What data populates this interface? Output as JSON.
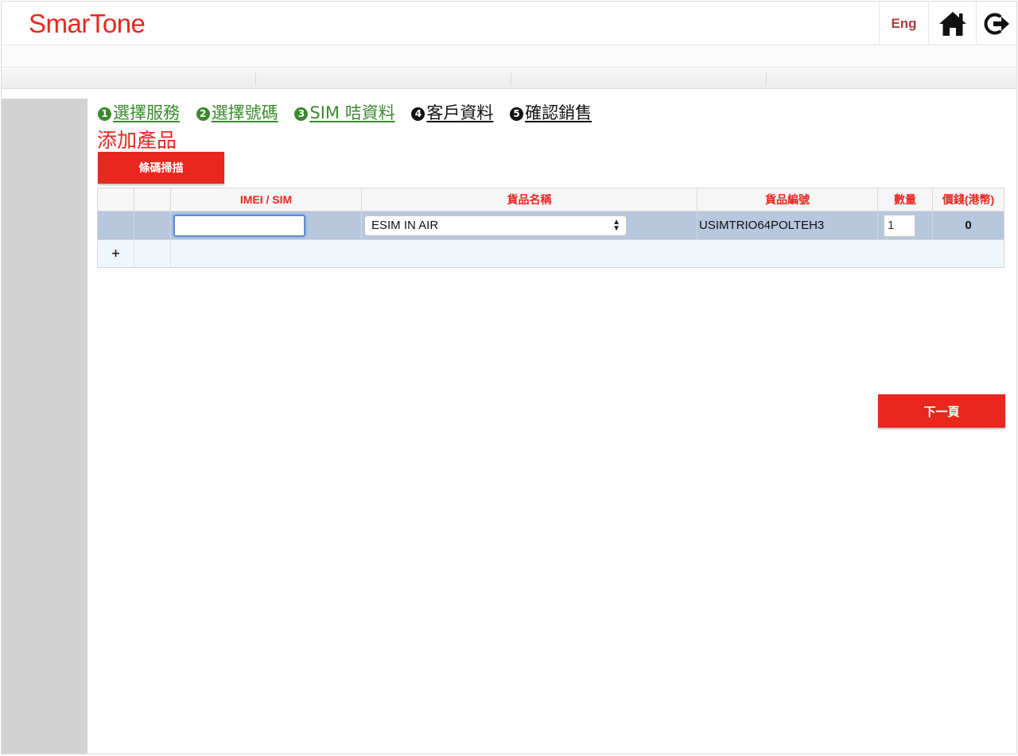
{
  "header": {
    "logo_text": "SmarTone",
    "lang_label": "Eng",
    "home_icon": "home-icon",
    "logout_icon": "logout-icon"
  },
  "steps": [
    {
      "num": "1",
      "label": "選擇服務",
      "state": "done"
    },
    {
      "num": "2",
      "label": "選擇號碼",
      "state": "done"
    },
    {
      "num": "3",
      "label": "SIM 咭資料",
      "state": "done"
    },
    {
      "num": "4",
      "label": "客戶資料",
      "state": "todo"
    },
    {
      "num": "5",
      "label": "確認銷售",
      "state": "todo"
    }
  ],
  "page_title": "添加產品",
  "scan_button_label": "條碼掃描",
  "table": {
    "columns": [
      "",
      "",
      "IMEI / SIM",
      "貨品名稱",
      "貨品編號",
      "數量",
      "價錢(港幣)"
    ],
    "rows": [
      {
        "imei": "",
        "product_name": "ESIM IN AIR",
        "product_code": "USIMTRIO64POLTEH3",
        "quantity": "1",
        "price": "0"
      }
    ],
    "add_label": "+"
  },
  "next_button_label": "下一頁",
  "colors": {
    "brand_red": "#e8271f",
    "step_done_green": "#3b8a2e",
    "selected_row_blue": "#b6c7de",
    "sidebar_gray": "#d3d3d3"
  }
}
